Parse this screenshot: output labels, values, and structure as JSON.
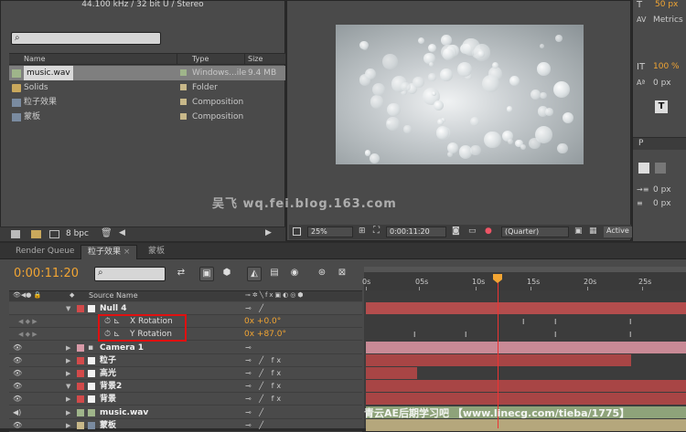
{
  "project": {
    "audio_info": "44.100 kHz / 32 bit U / Stereo",
    "search_placeholder": "⌕",
    "columns": {
      "name": "Name",
      "type": "Type",
      "size": "Size"
    },
    "items": [
      {
        "name": "music.wav",
        "type": "Windows...ile",
        "size": "9.4 MB"
      },
      {
        "name": "Solids",
        "type": "Folder",
        "size": ""
      },
      {
        "name": "粒子效果",
        "type": "Composition",
        "size": ""
      },
      {
        "name": "蒙板",
        "type": "Composition",
        "size": ""
      }
    ],
    "bpc": "8 bpc"
  },
  "comp_viewer": {
    "zoom": "25%",
    "timecode": "0:00:11:20",
    "resolution": "(Quarter)",
    "active_label": "Active"
  },
  "character_panel": {
    "size_value": "50 px",
    "metrics_label": "Metrics",
    "scale_value": "100 %",
    "baseline_value": "0 px",
    "indent_left": "0 px",
    "indent_bottom": "0 px",
    "tab_label": "P"
  },
  "watermark": "吴飞 wq.fei.blog.163.com",
  "timeline": {
    "tabs": [
      "Render Queue",
      "粒子效果",
      "蒙板"
    ],
    "timecode": "0:00:11:20",
    "search_placeholder": "⌕",
    "header_source_name": "Source Name",
    "ruler_ticks": [
      "0s",
      "05s",
      "10s",
      "15s",
      "20s",
      "25s"
    ],
    "layers": [
      {
        "name": "Null 4",
        "kind": "layer",
        "label_color": "#d24a4a"
      },
      {
        "name": "X Rotation",
        "kind": "prop",
        "value": "0x +0.0°"
      },
      {
        "name": "Y Rotation",
        "kind": "prop",
        "value": "0x +87.0°"
      },
      {
        "name": "Camera 1",
        "kind": "layer",
        "label_color": "#d99aa8"
      },
      {
        "name": "粒子",
        "kind": "layer",
        "label_color": "#d24a4a"
      },
      {
        "name": "高光",
        "kind": "layer",
        "label_color": "#d24a4a"
      },
      {
        "name": "背景2",
        "kind": "layer",
        "label_color": "#d24a4a"
      },
      {
        "name": "背景",
        "kind": "layer",
        "label_color": "#d24a4a"
      },
      {
        "name": "music.wav",
        "kind": "layer",
        "label_color": "#9fb58a"
      },
      {
        "name": "蒙板",
        "kind": "layer",
        "label_color": "#c8b889"
      }
    ]
  },
  "bottom_watermark": "青云AE后期学习吧 【www.linecg.com/tieba/1775】",
  "colors": {
    "accent": "#f2a533",
    "cti": "#e33333",
    "highlight_box": "#e01010"
  }
}
